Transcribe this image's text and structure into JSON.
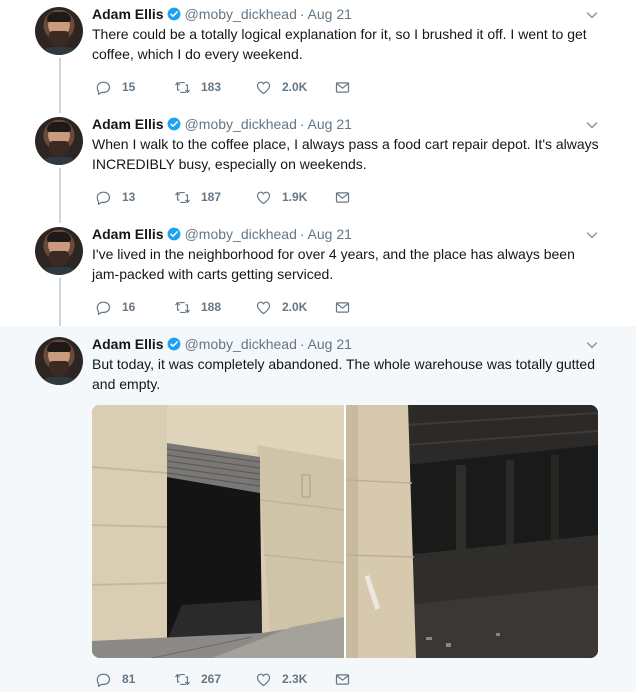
{
  "author": {
    "name": "Adam Ellis",
    "handle": "@moby_dickhead",
    "separator": "·",
    "date": "Aug 21"
  },
  "tweets": [
    {
      "text": "There could be a totally logical explanation for it, so I brushed it off. I went to get coffee, which I do every weekend.",
      "replies": "15",
      "retweets": "183",
      "likes": "2.0K"
    },
    {
      "text": "When I walk to the coffee place, I always pass a food cart repair depot. It's always INCREDIBLY busy, especially on weekends.",
      "replies": "13",
      "retweets": "187",
      "likes": "1.9K"
    },
    {
      "text": "I've lived in the neighborhood for over 4 years, and the place has always been jam-packed with carts getting serviced.",
      "replies": "16",
      "retweets": "188",
      "likes": "2.0K"
    },
    {
      "text": "But today, it was completely abandoned. The whole warehouse was totally gutted and empty.",
      "replies": "81",
      "retweets": "267",
      "likes": "2.3K"
    }
  ],
  "colors": {
    "verified": "#1da1f2",
    "muted": "#657786",
    "highlight_bg": "#f5f8fa",
    "thread_line": "#ccd6dd"
  },
  "icons": [
    "verified-badge-icon",
    "chevron-down-icon",
    "reply-icon",
    "retweet-icon",
    "like-icon",
    "direct-message-icon"
  ]
}
